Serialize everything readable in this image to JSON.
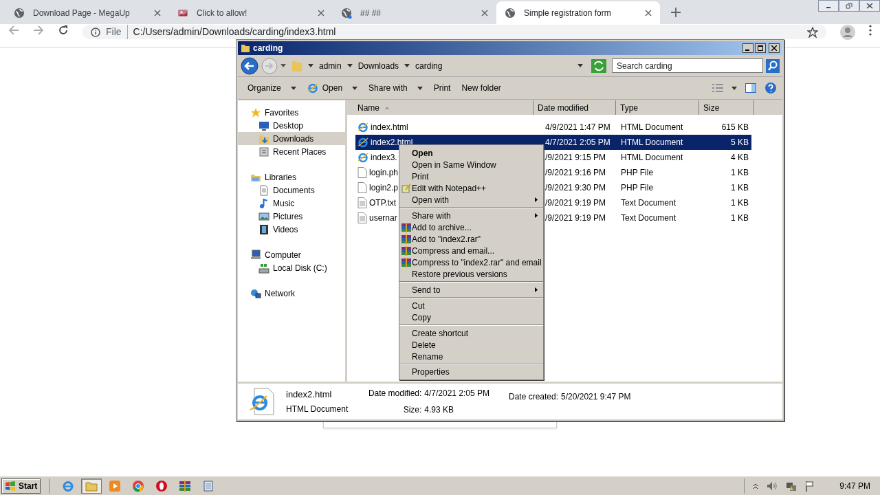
{
  "browser": {
    "tabs": [
      {
        "title": "Download Page - MegaUp",
        "kind": "globe",
        "selected": false
      },
      {
        "title": "Click to allow!",
        "kind": "image",
        "selected": false
      },
      {
        "title": "## ##",
        "kind": "globe-dot",
        "selected": false
      },
      {
        "title": "Simple registration form",
        "kind": "globe",
        "selected": true
      }
    ],
    "address": {
      "scheme": "File",
      "url": "C:/Users/admin/Downloads/carding/index3.html"
    }
  },
  "explorer": {
    "title": "carding",
    "breadcrumb": [
      "admin",
      "Downloads",
      "carding"
    ],
    "search": {
      "placeholder": "Search carding"
    },
    "toolbar": [
      {
        "label": "Organize",
        "kind": "dropdown"
      },
      {
        "label": "Open",
        "kind": "ie-dropdown"
      },
      {
        "label": "Share with",
        "kind": "dropdown"
      },
      {
        "label": "Print",
        "kind": "plain"
      },
      {
        "label": "New folder",
        "kind": "plain"
      }
    ],
    "nav": [
      {
        "label": "Favorites",
        "kind": "star",
        "selected": false,
        "children": [
          {
            "label": "Desktop",
            "kind": "desktop",
            "selected": false
          },
          {
            "label": "Downloads",
            "kind": "downloads",
            "selected": true
          },
          {
            "label": "Recent Places",
            "kind": "recent",
            "selected": false
          }
        ]
      },
      {
        "label": "Libraries",
        "kind": "libraries",
        "selected": false,
        "children": [
          {
            "label": "Documents",
            "kind": "documents",
            "selected": false
          },
          {
            "label": "Music",
            "kind": "music",
            "selected": false
          },
          {
            "label": "Pictures",
            "kind": "pictures",
            "selected": false
          },
          {
            "label": "Videos",
            "kind": "videos",
            "selected": false
          }
        ]
      },
      {
        "label": "Computer",
        "kind": "computer",
        "selected": false,
        "children": [
          {
            "label": "Local Disk (C:)",
            "kind": "disk",
            "selected": false
          }
        ]
      },
      {
        "label": "Network",
        "kind": "network",
        "selected": false
      }
    ],
    "columns": [
      "Name",
      "Date modified",
      "Type",
      "Size"
    ],
    "rows": [
      {
        "name": "index.html",
        "kind": "ie",
        "date": "4/9/2021 1:47 PM",
        "type": "HTML Document",
        "size": "615 KB",
        "selected": false
      },
      {
        "name": "index2.html",
        "kind": "ie",
        "date": "4/7/2021 2:05 PM",
        "type": "HTML Document",
        "size": "5 KB",
        "selected": true
      },
      {
        "name": "index3.",
        "kind": "ie",
        "date": "/9/2021 9:15 PM",
        "type": "HTML Document",
        "size": "4 KB",
        "selected": false
      },
      {
        "name": "login.ph",
        "kind": "file",
        "date": "/9/2021 9:16 PM",
        "type": "PHP File",
        "size": "1 KB",
        "selected": false
      },
      {
        "name": "login2.p",
        "kind": "file",
        "date": "/9/2021 9:30 PM",
        "type": "PHP File",
        "size": "1 KB",
        "selected": false
      },
      {
        "name": "OTP.txt",
        "kind": "text",
        "date": "/9/2021 9:19 PM",
        "type": "Text Document",
        "size": "1 KB",
        "selected": false
      },
      {
        "name": "usernar",
        "kind": "text",
        "date": "/9/2021 9:19 PM",
        "type": "Text Document",
        "size": "1 KB",
        "selected": false
      }
    ],
    "details": {
      "name": "index2.html",
      "type": "HTML Document",
      "modified_label": "Date modified:",
      "modified": "4/7/2021 2:05 PM",
      "size_label": "Size:",
      "size": "4.93 KB",
      "created_label": "Date created:",
      "created": "5/20/2021 9:47 PM"
    }
  },
  "context_menu": [
    [
      {
        "label": "Open",
        "kind": "default"
      },
      {
        "label": "Open in Same Window",
        "kind": "plain"
      },
      {
        "label": "Print",
        "kind": "plain"
      },
      {
        "label": "Edit with Notepad++",
        "kind": "notepad"
      },
      {
        "label": "Open with",
        "kind": "submenu"
      }
    ],
    [
      {
        "label": "Share with",
        "kind": "submenu"
      },
      {
        "label": "Add to archive...",
        "kind": "archive"
      },
      {
        "label": "Add to \"index2.rar\"",
        "kind": "archive"
      },
      {
        "label": "Compress and email...",
        "kind": "archive"
      },
      {
        "label": "Compress to \"index2.rar\" and email",
        "kind": "archive"
      },
      {
        "label": "Restore previous versions",
        "kind": "plain"
      }
    ],
    [
      {
        "label": "Send to",
        "kind": "submenu"
      }
    ],
    [
      {
        "label": "Cut",
        "kind": "plain"
      },
      {
        "label": "Copy",
        "kind": "plain"
      }
    ],
    [
      {
        "label": "Create shortcut",
        "kind": "plain"
      },
      {
        "label": "Delete",
        "kind": "plain"
      },
      {
        "label": "Rename",
        "kind": "plain"
      }
    ],
    [
      {
        "label": "Properties",
        "kind": "plain"
      }
    ]
  ],
  "taskbar": {
    "start": "Start",
    "apps": [
      {
        "kind": "ie",
        "selected": false
      },
      {
        "kind": "explorer",
        "selected": true
      },
      {
        "kind": "media",
        "selected": false
      },
      {
        "kind": "chrome",
        "selected": false
      },
      {
        "kind": "opera",
        "selected": false
      },
      {
        "kind": "winrar",
        "selected": false
      },
      {
        "kind": "notepad",
        "selected": false
      }
    ],
    "clock": "9:47 PM"
  }
}
